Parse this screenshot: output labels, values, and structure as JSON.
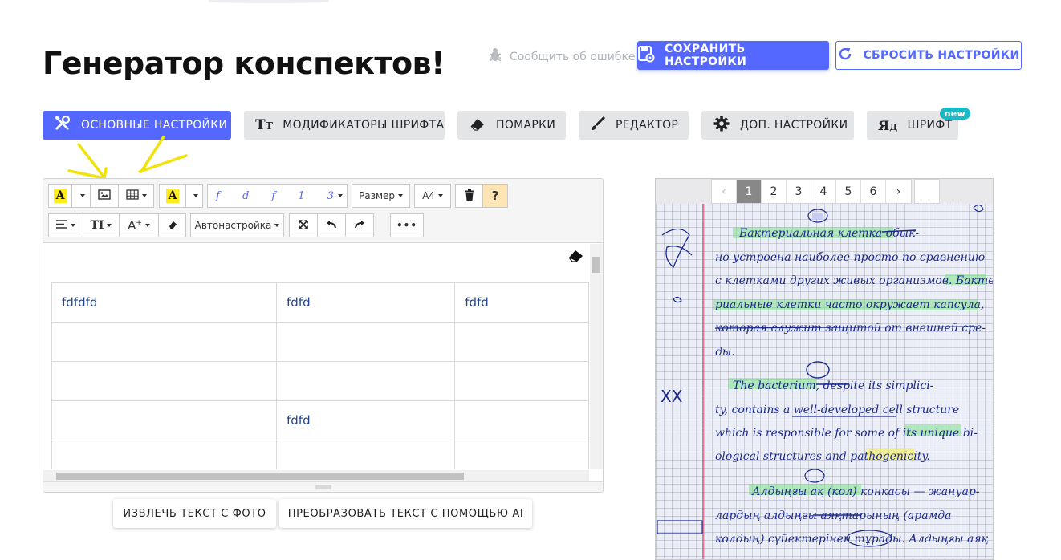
{
  "header": {
    "title": "Генератор конспектов!",
    "report_label": "Сообщить об ошибке",
    "save_label": "СОХРАНИТЬ НАСТРОЙКИ",
    "reset_label": "СБРОСИТЬ НАСТРОЙКИ"
  },
  "tabs": [
    {
      "label": "ОСНОВНЫЕ НАСТРОЙКИ",
      "icon": "tools-icon",
      "active": true
    },
    {
      "label": "МОДИФИКАТОРЫ ШРИФТА",
      "icon": "font-size-icon"
    },
    {
      "label": "ПОМАРКИ",
      "icon": "eraser-icon"
    },
    {
      "label": "РЕДАКТОР",
      "icon": "brush-icon"
    },
    {
      "label": "ДОП. НАСТРОЙКИ",
      "icon": "gear-icon"
    },
    {
      "label": "ШРИФТ",
      "icon": "font-family-icon",
      "badge": "new"
    }
  ],
  "toolbar": {
    "size_label": "Размер",
    "paper_label": "A4",
    "autoadjust_label": "Автонастройка",
    "font_preview": "f d f 1 3",
    "help_label": "?",
    "more_label": "•••"
  },
  "table": {
    "rows": [
      [
        "fdfdfd",
        "fdfd",
        "fdfd"
      ],
      [
        "",
        "",
        ""
      ],
      [
        "",
        "",
        ""
      ],
      [
        "",
        "fdfd",
        ""
      ],
      [
        "",
        "",
        ""
      ]
    ]
  },
  "actions": {
    "extract_label": "ИЗВЛЕЧЬ ТЕКСТ С ФОТО",
    "ai_label": "ПРЕОБРАЗОВАТЬ ТЕКСТ С ПОМОЩЬЮ AI"
  },
  "preview": {
    "pages": [
      "‹",
      "1",
      "2",
      "3",
      "4",
      "5",
      "6",
      "›"
    ],
    "current_page": "1",
    "handwriting_lines": [
      "Бактериальная клетка обык-",
      "но устроена наиболее просто по сравнению",
      "с клетками других живых организмов. Бакте-",
      "риальные клетки часто окружает капсула,",
      "которая служит защитой от внешней сре-",
      "ды.",
      "The bacterium, despite its simplici-",
      "ty, contains a well-developed cell structure",
      "which is responsible for some of its unique bi-",
      "ological structures and pathogenicity.",
      "Алдыңғы ақ (кол) конкасы — жануар-",
      "лардың алдыңғы аяқтарының (арамда",
      "колдың) сүйектерінен тұрады. Алдыңғы аяқ"
    ],
    "margin_mark": "XX"
  },
  "colors": {
    "accent": "#5468ff",
    "highlight_green": "#7ee08a",
    "highlight_yellow": "#f4f06a",
    "ink": "#1c2a8c",
    "badge": "#1ab9c6"
  }
}
